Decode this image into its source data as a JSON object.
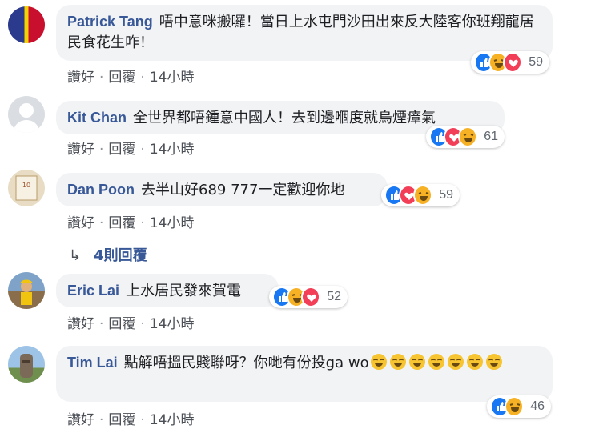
{
  "actions": {
    "like": "讚好",
    "reply": "回覆",
    "sep": "·"
  },
  "colors": {
    "author": "#385898",
    "bubble": "#f2f3f5",
    "like": "#1877f2",
    "haha": "#f7b125",
    "love": "#f33e58"
  },
  "comments": [
    {
      "author": "Patrick Tang",
      "text": "唔中意咪搬囉！當日上水屯門沙田出來反大陸客你班翔龍居民食花生咋！",
      "time": "14小時",
      "reactions": [
        "like",
        "haha",
        "love"
      ],
      "count": "59"
    },
    {
      "author": "Kit Chan",
      "text": "全世界都唔鍾意中國人！去到邊嗰度就烏煙瘴氣",
      "time": "14小時",
      "reactions": [
        "like",
        "love",
        "haha"
      ],
      "count": "61"
    },
    {
      "author": "Dan Poon",
      "text": "去半山好689 777一定歡迎你地",
      "time": "14小時",
      "reactions": [
        "like",
        "love",
        "haha"
      ],
      "count": "59",
      "replies_label": "4則回覆"
    },
    {
      "author": "Eric Lai",
      "text": "上水居民發來賀電",
      "time": "14小時",
      "reactions": [
        "like",
        "haha",
        "love"
      ],
      "count": "52"
    },
    {
      "author": "Tim Lai",
      "text": "點解唔搵民賤聯呀？你哋有份投ga wo",
      "time": "14小時",
      "reactions": [
        "like",
        "haha"
      ],
      "count": "46",
      "emoji": [
        "zany-face",
        "zany-face",
        "zany-face",
        "rofl-face",
        "rofl-face",
        "rofl-face",
        "rofl-face"
      ]
    }
  ]
}
